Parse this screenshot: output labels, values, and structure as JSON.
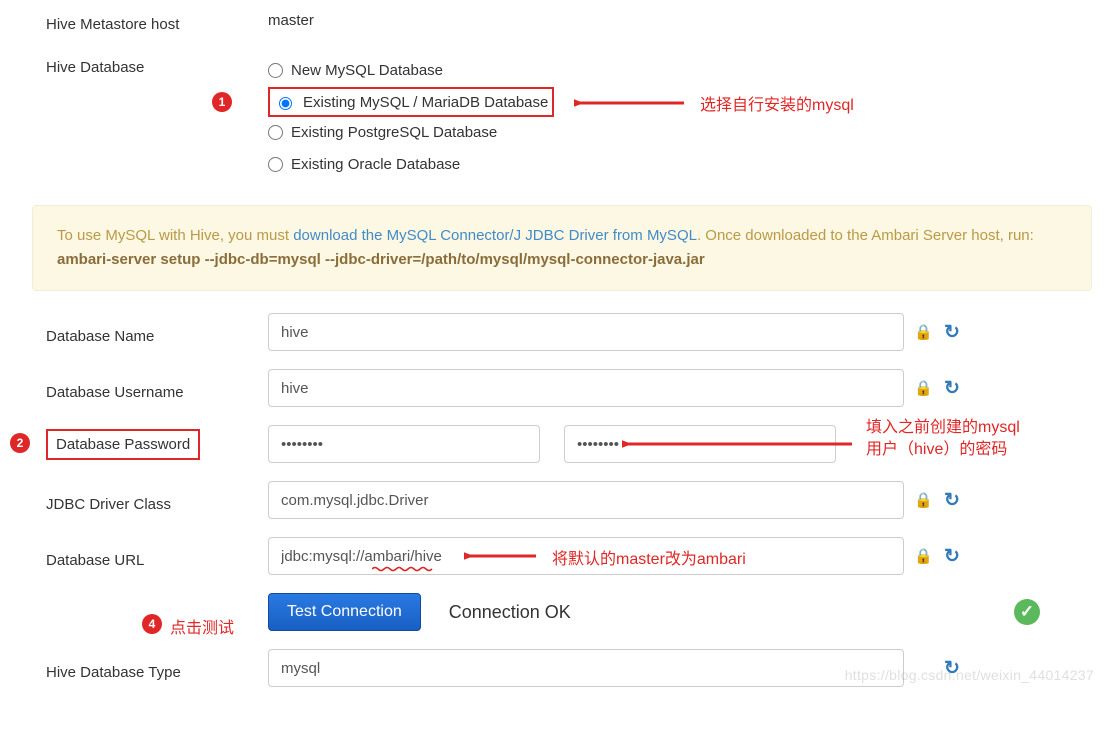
{
  "fields": {
    "metastore_host": {
      "label": "Hive Metastore host",
      "value": "master"
    },
    "hive_database": {
      "label": "Hive Database"
    },
    "db_name": {
      "label": "Database Name",
      "value": "hive"
    },
    "db_user": {
      "label": "Database Username",
      "value": "hive"
    },
    "db_pass": {
      "label": "Database Password",
      "value": "••••••••",
      "confirm": "••••••••"
    },
    "driver_class": {
      "label": "JDBC Driver Class",
      "value": "com.mysql.jdbc.Driver"
    },
    "db_url": {
      "label": "Database URL",
      "value": "jdbc:mysql://ambari/hive"
    },
    "db_type": {
      "label": "Hive Database Type",
      "value": "mysql"
    }
  },
  "radio_options": [
    {
      "label": "New MySQL Database",
      "selected": false
    },
    {
      "label": "Existing MySQL / MariaDB Database",
      "selected": true
    },
    {
      "label": "Existing PostgreSQL Database",
      "selected": false
    },
    {
      "label": "Existing Oracle Database",
      "selected": false
    }
  ],
  "info_box": {
    "lead": "To use MySQL with Hive, you must ",
    "link": "download the MySQL Connector/J JDBC Driver from MySQL",
    "tail1": ". Once downloaded to the Ambari Server host, run:",
    "cmd": "ambari-server setup --jdbc-db=mysql --jdbc-driver=/path/to/mysql/mysql-connector-java.jar"
  },
  "buttons": {
    "test": "Test Connection"
  },
  "status": {
    "conn_ok": "Connection OK"
  },
  "annotations": {
    "a1": "选择自行安装的mysql",
    "a2_l1": "填入之前创建的mysql",
    "a2_l2": "用户（hive）的密码",
    "a3": "将默认的master改为ambari",
    "a4": "点击测试"
  },
  "watermark": "https://blog.csdn.net/weixin_44014237"
}
